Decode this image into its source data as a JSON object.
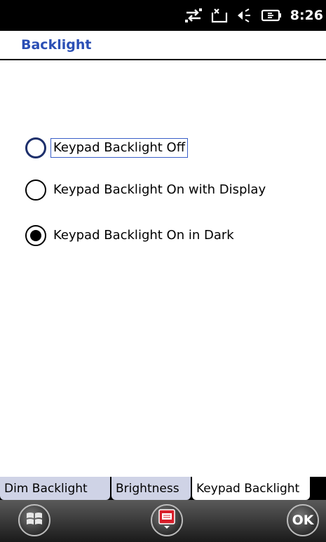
{
  "status_bar": {
    "time": "8:26",
    "icons": [
      "connectivity-arrows-icon",
      "no-signal-icon",
      "speaker-icon",
      "battery-charging-icon"
    ]
  },
  "header": {
    "title": "Backlight"
  },
  "options": [
    {
      "label": "Keypad Backlight Off",
      "selected": false,
      "focused": true
    },
    {
      "label": "Keypad Backlight On with Display",
      "selected": false,
      "focused": false
    },
    {
      "label": "Keypad Backlight On in Dark",
      "selected": true,
      "focused": false
    }
  ],
  "tabs": [
    {
      "label": "Dim Backlight",
      "active": false
    },
    {
      "label": "Brightness",
      "active": false
    },
    {
      "label": "Keypad Backlight",
      "active": true
    }
  ],
  "bottom_bar": {
    "ok_label": "OK",
    "icons": [
      "windows-start-icon",
      "keyboard-icon",
      "ok-button"
    ]
  },
  "colors": {
    "title": "#2b4fb5",
    "tab_inactive": "#cfd3e6",
    "tab_active": "#ffffff"
  }
}
